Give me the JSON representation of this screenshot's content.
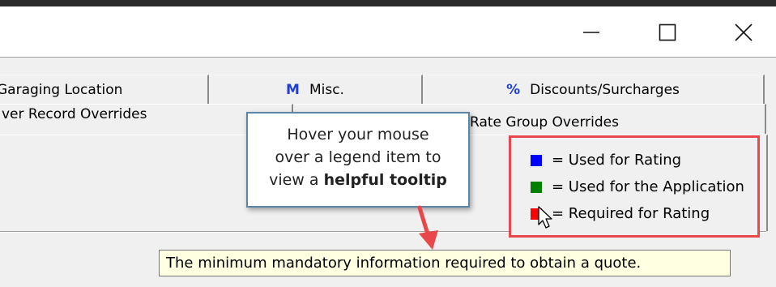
{
  "window": {
    "minimize_icon": "minimize-icon",
    "maximize_icon": "maximize-icon",
    "close_icon": "close-icon"
  },
  "tabs_row1": [
    {
      "label": "Garaging Location",
      "icon": ""
    },
    {
      "label": "Misc.",
      "icon": "M"
    },
    {
      "label": "Discounts/Surcharges",
      "icon": "%"
    }
  ],
  "tabs_row2": [
    {
      "label": "ver Record Overrides"
    },
    {
      "label": "Rate Group Overrides"
    }
  ],
  "legend": {
    "items": [
      {
        "label": "= Used for Rating",
        "color": "#0000ff"
      },
      {
        "label": "= Used for the Application",
        "color": "#008000"
      },
      {
        "label": "= Required for Rating",
        "color": "#ff0000"
      }
    ],
    "highlight_color": "#e8484b"
  },
  "callout": {
    "line1": "Hover your mouse",
    "line2": "over a legend item to",
    "line3_prefix": "view a ",
    "line3_bold": "helpful tooltip",
    "arrow_color": "#e8484b"
  },
  "tooltip": {
    "text": "The minimum mandatory information required to obtain a quote."
  }
}
